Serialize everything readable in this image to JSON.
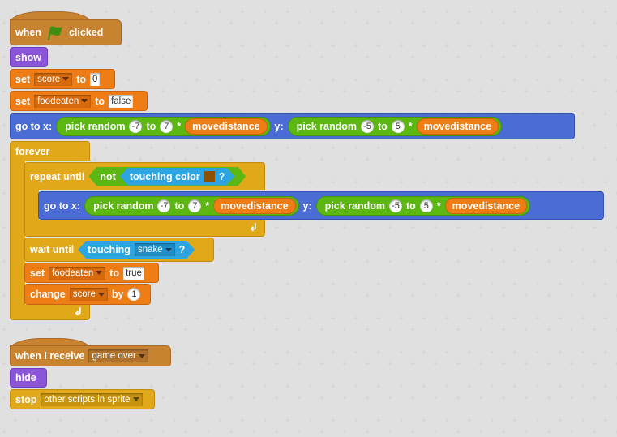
{
  "scripts": [
    {
      "hat": {
        "when": "when",
        "icon": "green-flag",
        "clicked": "clicked"
      },
      "show": "show",
      "set_score": {
        "label": "set",
        "var": "score",
        "to": "to",
        "value": "0"
      },
      "set_food": {
        "label": "set",
        "var": "foodeaten",
        "to": "to",
        "value": "false"
      },
      "goto": {
        "label": "go to x:",
        "x": {
          "pick": "pick random",
          "from": "-7",
          "to": "to",
          "to_value": "7",
          "times": "*",
          "var": "movedistance"
        },
        "ylabel": "y:",
        "y": {
          "pick": "pick random",
          "from": "-5",
          "to": "to",
          "to_value": "5",
          "times": "*",
          "var": "movedistance"
        }
      },
      "forever": {
        "label": "forever",
        "repeat": {
          "label": "repeat until",
          "not": "not",
          "touching_color": "touching color",
          "color": "#8b5000",
          "q": "?",
          "goto": {
            "label": "go to x:",
            "x": {
              "pick": "pick random",
              "from": "-7",
              "to": "to",
              "to_value": "7",
              "times": "*",
              "var": "movedistance"
            },
            "ylabel": "y:",
            "y": {
              "pick": "pick random",
              "from": "-5",
              "to": "to",
              "to_value": "5",
              "times": "*",
              "var": "movedistance"
            }
          }
        },
        "wait": {
          "label": "wait until",
          "touching": "touching",
          "target": "snake",
          "q": "?"
        },
        "set_food": {
          "label": "set",
          "var": "foodeaten",
          "to": "to",
          "value": "true"
        },
        "change": {
          "label": "change",
          "var": "score",
          "by": "by",
          "value": "1"
        }
      }
    },
    {
      "hat": {
        "label": "when I receive",
        "message": "game over"
      },
      "hide": "hide",
      "stop": {
        "label": "stop",
        "option": "other scripts in sprite"
      }
    }
  ],
  "loop_arrow": "↲",
  "colors": {
    "events": "#c88330",
    "looks": "#8a55d7",
    "data": "#ee7d16",
    "motion": "#4a6cd4",
    "control": "#e1a91a",
    "operators": "#5cb712",
    "sensing": "#2ca5e2"
  }
}
